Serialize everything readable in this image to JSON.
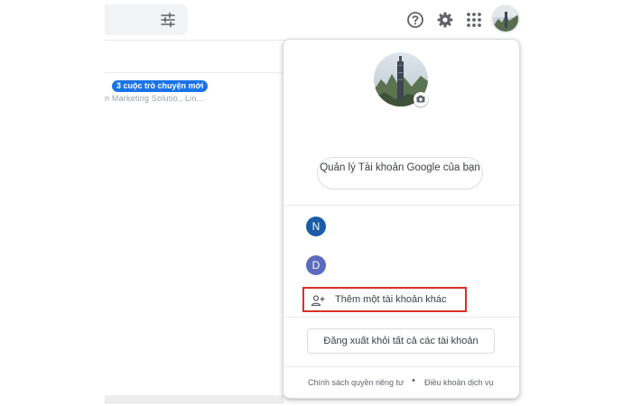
{
  "header": {
    "icons": {
      "search_options": "tune-icon",
      "help": "help-icon",
      "settings": "gear-icon",
      "apps": "apps-grid-icon",
      "account": "avatar"
    }
  },
  "mail_list": {
    "badge": "3 cuộc trò chuyện mới",
    "snippet": "n Marketing Solutio., Lin..."
  },
  "account_panel": {
    "manage_button": "Quản lý Tài khoản Google của bạn",
    "accounts": [
      {
        "initial": "N",
        "color": "#1a5da6"
      },
      {
        "initial": "D",
        "color": "#5c6bc0"
      }
    ],
    "add_account": "Thêm một tài khoản khác",
    "sign_out_all": "Đăng xuất khỏi tất cả các tài khoản",
    "footer": {
      "privacy": "Chính sách quyền riêng tư",
      "separator": "•",
      "terms": "Điều khoản dịch vụ"
    }
  },
  "colors": {
    "accent": "#1a73e8",
    "highlight_border": "#d93025",
    "divider": "#e8eaed"
  }
}
